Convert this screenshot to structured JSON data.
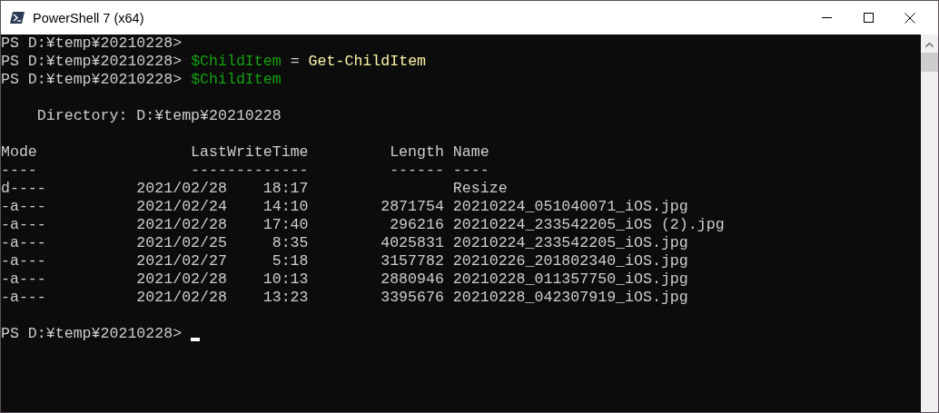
{
  "window": {
    "title": "PowerShell 7 (x64)"
  },
  "console": {
    "commands": [
      {
        "prompt": "PS D:¥temp¥20210228>"
      },
      {
        "prompt": "PS D:¥temp¥20210228>",
        "tokens": [
          {
            "kind": "variable",
            "text": "$ChildItem"
          },
          {
            "kind": "operator",
            "text": "="
          },
          {
            "kind": "command",
            "text": "Get-ChildItem"
          }
        ]
      },
      {
        "prompt": "PS D:¥temp¥20210228>",
        "tokens": [
          {
            "kind": "variable",
            "text": "$ChildItem"
          }
        ]
      }
    ],
    "directory": "Directory: D:¥temp¥20210228",
    "columns": [
      {
        "label": "Mode",
        "rule": "----"
      },
      {
        "label": "LastWriteTime",
        "rule": "-------------"
      },
      {
        "label": "Length",
        "rule": "------"
      },
      {
        "label": "Name",
        "rule": "----"
      }
    ],
    "rows": [
      {
        "mode": "d----",
        "date": "2021/02/28",
        "time": "18:17",
        "length": "",
        "name": "Resize"
      },
      {
        "mode": "-a---",
        "date": "2021/02/24",
        "time": "14:10",
        "length": "2871754",
        "name": "20210224_051040071_iOS.jpg"
      },
      {
        "mode": "-a---",
        "date": "2021/02/28",
        "time": "17:40",
        "length": "296216",
        "name": "20210224_233542205_iOS (2).jpg"
      },
      {
        "mode": "-a---",
        "date": "2021/02/25",
        "time": "8:35",
        "length": "4025831",
        "name": "20210224_233542205_iOS.jpg"
      },
      {
        "mode": "-a---",
        "date": "2021/02/27",
        "time": "5:18",
        "length": "3157782",
        "name": "20210226_201802340_iOS.jpg"
      },
      {
        "mode": "-a---",
        "date": "2021/02/28",
        "time": "10:13",
        "length": "2880946",
        "name": "20210228_011357750_iOS.jpg"
      },
      {
        "mode": "-a---",
        "date": "2021/02/28",
        "time": "13:23",
        "length": "3395676",
        "name": "20210228_042307919_iOS.jpg"
      }
    ],
    "final_prompt": "PS D:¥temp¥20210228>"
  }
}
